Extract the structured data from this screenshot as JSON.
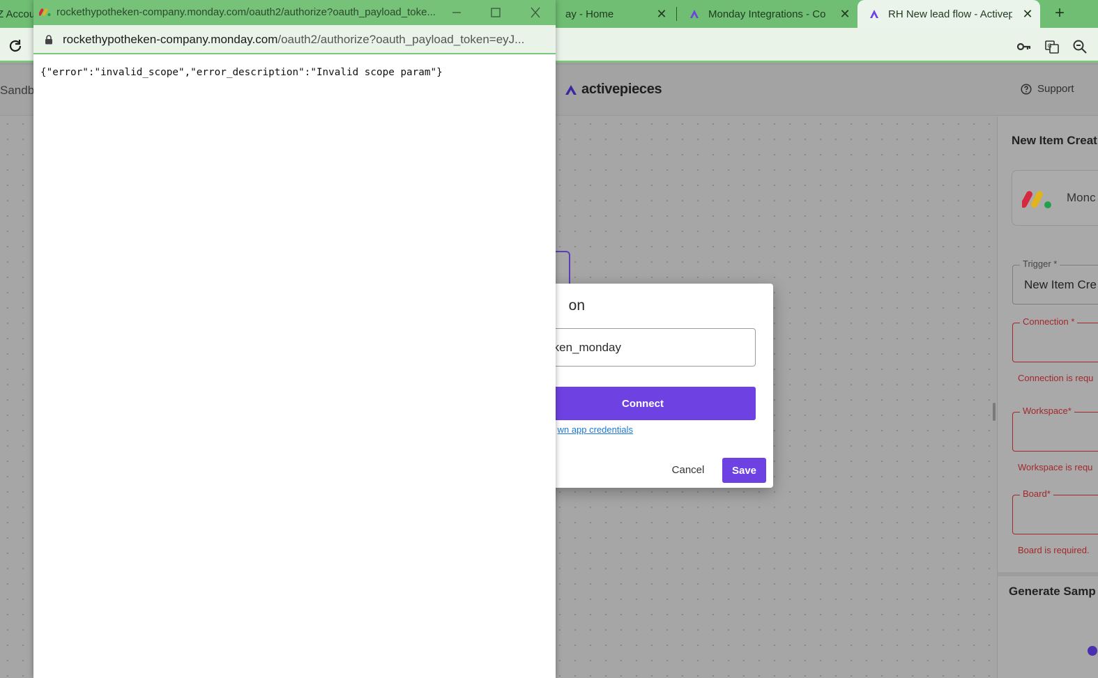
{
  "browser": {
    "tabs": [
      {
        "label": "Z Account",
        "active": false
      },
      {
        "label": "ay - Home",
        "active": false
      },
      {
        "label": "Monday Integrations - Co",
        "active": false
      },
      {
        "label": "RH New lead flow - Activep",
        "active": true
      }
    ],
    "new_tab_label": "+"
  },
  "app": {
    "sandbox_label": "Sandb",
    "logo_text": "activepieces",
    "support_label": "Support",
    "panel": {
      "title": "New Item Creat",
      "piece_name": "Monc",
      "trigger_label": "Trigger *",
      "trigger_value": "New Item Cre",
      "connection_label": "Connection *",
      "connection_error": "Connection is requ",
      "workspace_label": "Workspace*",
      "workspace_error": "Workspace is requ",
      "board_label": "Board*",
      "board_error": "Board is required.",
      "generate_title": "Generate Samp"
    }
  },
  "dialog": {
    "title_fragment": "on",
    "input_value_fragment": "ken_monday",
    "connect_label": "Connect",
    "credentials_link_fragment": "wn app credentials",
    "cancel_label": "Cancel",
    "save_label": "Save"
  },
  "popup": {
    "title": "rockethypotheken-company.monday.com/oauth2/authorize?oauth_payload_toke...",
    "url_host": "rockethypotheken-company.monday.com",
    "url_path": "/oauth2/authorize?oauth_payload_token=eyJ...",
    "body_text": "{\"error\":\"invalid_scope\",\"error_description\":\"Invalid scope param\"}"
  },
  "colors": {
    "accent": "#6e41e2",
    "chrome_green": "#6fbe73",
    "error_red": "#a3282b",
    "link_blue": "#1c78d8"
  }
}
